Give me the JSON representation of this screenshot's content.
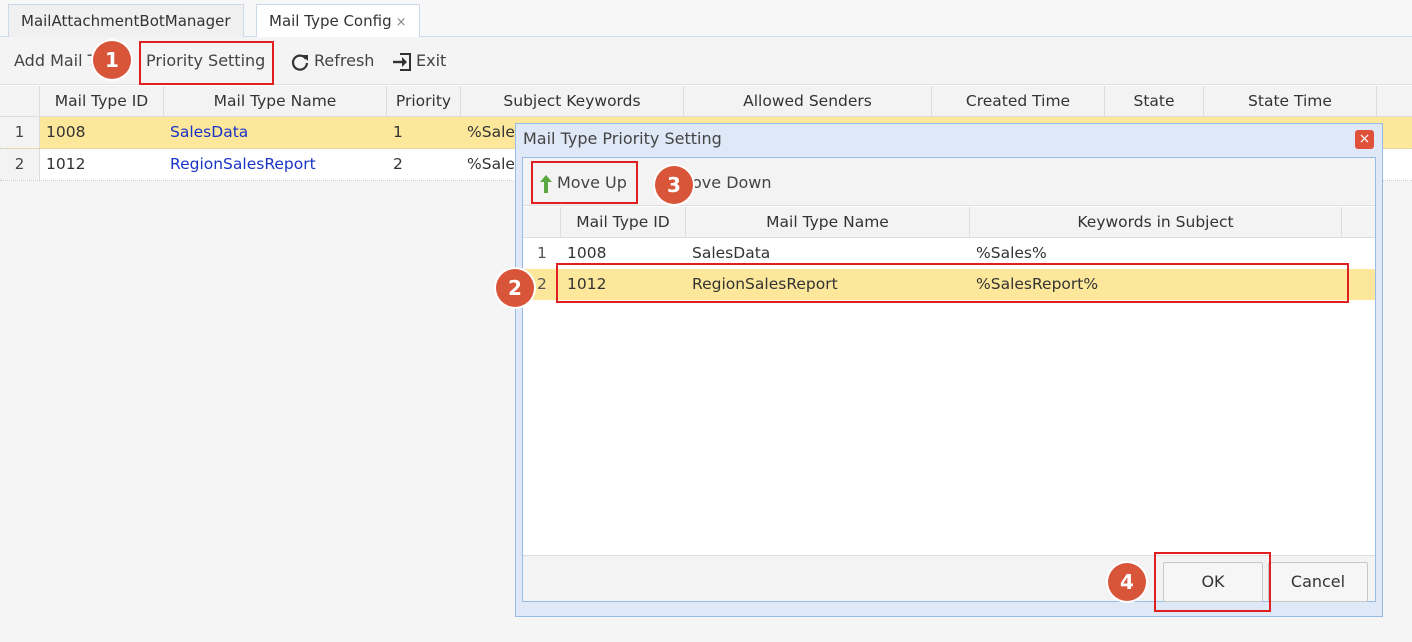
{
  "tabs": [
    {
      "label": "MailAttachmentBotManager"
    },
    {
      "label": "Mail Type Config",
      "close": "×"
    }
  ],
  "toolbar": {
    "add_label": "Add Mail T",
    "priority_label": "Priority Setting",
    "refresh_label": "Refresh",
    "exit_label": "Exit"
  },
  "grid": {
    "columns": [
      "Mail Type ID",
      "Mail Type Name",
      "Priority",
      "Subject Keywords",
      "Allowed Senders",
      "Created Time",
      "State",
      "State Time"
    ],
    "rows": [
      {
        "num": "1",
        "id": "1008",
        "name": "SalesData",
        "priority": "1",
        "keywords": "%Sales"
      },
      {
        "num": "2",
        "id": "1012",
        "name": "RegionSalesReport",
        "priority": "2",
        "keywords": "%Sales"
      }
    ]
  },
  "dialog": {
    "title": "Mail Type Priority Setting",
    "close": "×",
    "move_up_label": "Move Up",
    "move_down_label": "ove Down",
    "columns": [
      "Mail Type ID",
      "Mail Type Name",
      "Keywords in Subject"
    ],
    "rows": [
      {
        "num": "1",
        "id": "1008",
        "name": "SalesData",
        "keywords": "%Sales%"
      },
      {
        "num": "2",
        "id": "1012",
        "name": "RegionSalesReport",
        "keywords": "%SalesReport%"
      }
    ],
    "ok_label": "OK",
    "cancel_label": "Cancel"
  },
  "annotations": [
    "1",
    "2",
    "3",
    "4"
  ],
  "colors": {
    "selected_row": "#fce79a",
    "highlight_box": "#e02020",
    "badge": "#d9553a",
    "link": "#1a33c7",
    "dialog_border": "#99bbe8"
  }
}
